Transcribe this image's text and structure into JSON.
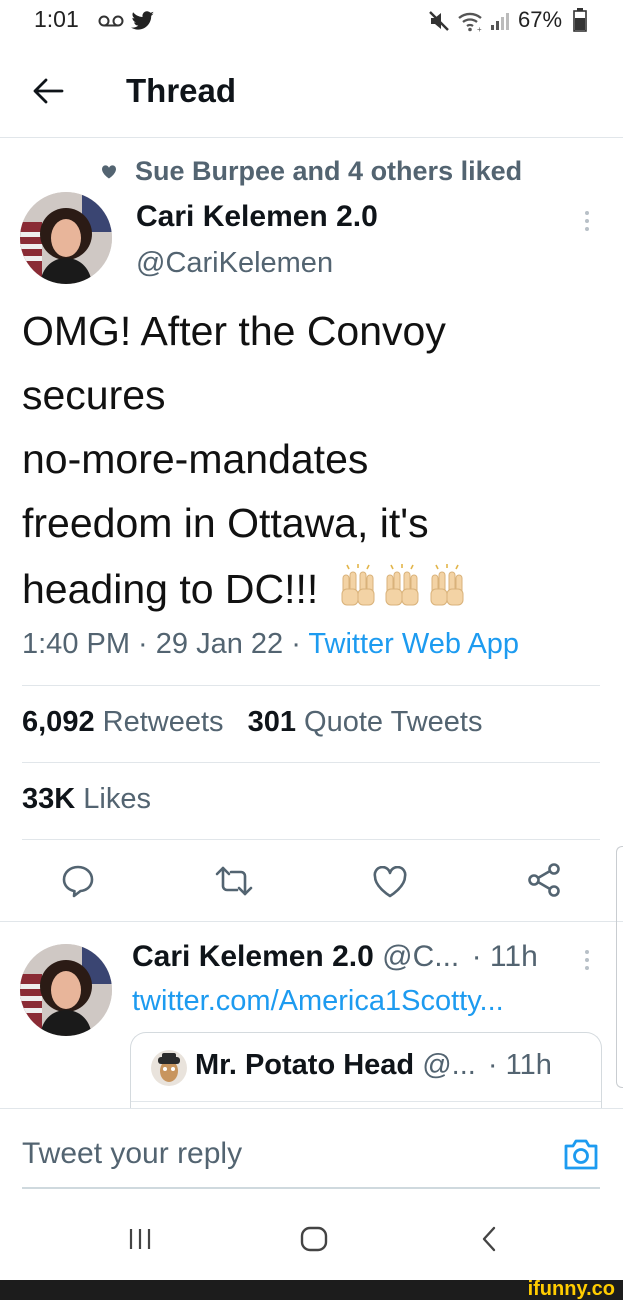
{
  "status_bar": {
    "time": "1:01",
    "battery": "67%"
  },
  "header": {
    "title": "Thread"
  },
  "social_context": "Sue Burpee and 4 others liked",
  "tweet": {
    "author_name": "Cari Kelemen 2.0",
    "author_handle": "@CariKelemen",
    "text_lines": [
      "OMG! After the Convoy",
      "secures",
      "no-more-mandates",
      "freedom in Ottawa, it's",
      "heading to DC!!!"
    ],
    "time": "1:40 PM",
    "date": "29 Jan 22",
    "source": "Twitter Web App",
    "retweets_count": "6,092",
    "retweets_label": "Retweets",
    "quotes_count": "301",
    "quotes_label": "Quote Tweets",
    "likes_count": "33K",
    "likes_label": "Likes"
  },
  "reply": {
    "author_name": "Cari Kelemen 2.0",
    "author_handle": "@C...",
    "time": "· 11h",
    "link": "twitter.com/America1Scotty...",
    "quoted": {
      "name": "Mr. Potato Head",
      "handle": "@...",
      "time": "· 11h"
    }
  },
  "compose": {
    "placeholder": "Tweet your reply"
  },
  "watermark": "ifunny.co",
  "colors": {
    "accent": "#1d9bf0",
    "secondary_text": "#536471",
    "divider": "#e1e6ea"
  },
  "icons": [
    "voicemail-icon",
    "twitter-bird-icon",
    "mute-icon",
    "wifi-icon",
    "signal-icon",
    "battery-icon",
    "back-arrow-icon",
    "heart-icon",
    "more-vertical-icon",
    "reply-icon",
    "retweet-icon",
    "like-icon",
    "share-icon",
    "camera-icon",
    "recent-apps-icon",
    "home-icon",
    "system-back-icon"
  ]
}
